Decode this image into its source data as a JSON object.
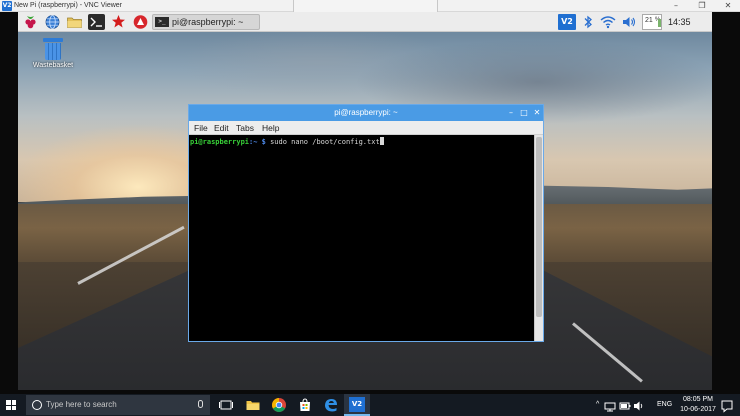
{
  "vnc": {
    "logo_text": "V2",
    "title": "New Pi (raspberrypi) - VNC Viewer",
    "minimize": "–",
    "maximize": "❐",
    "close": "✕"
  },
  "pi_panel": {
    "task_label": "pi@raspberrypi: ~",
    "task_icon_text": ">_",
    "vnc_tray_text": "V2",
    "cpu_text": "21",
    "cpu_suffix": "%",
    "clock": "14:35"
  },
  "desktop": {
    "icons": [
      {
        "label": "Wastebasket"
      }
    ]
  },
  "terminal": {
    "title": "pi@raspberrypi: ~",
    "menu": [
      "File",
      "Edit",
      "Tabs",
      "Help"
    ],
    "prompt_user": "pi@raspberrypi",
    "prompt_path": ":~ $",
    "command": " sudo nano /boot/config.txt",
    "minimize": "–",
    "maximize": "□",
    "close": "✕"
  },
  "taskbar": {
    "search_placeholder": "Type here to search",
    "vnc_text": "V2",
    "lang": "ENG",
    "time": "08:05 PM",
    "date": "10-06-2017"
  },
  "colors": {
    "terminal_title_blue": "#4a9be5",
    "prompt_green": "#38d138",
    "prompt_blue": "#4f8df0",
    "taskbar": "#141a22"
  }
}
